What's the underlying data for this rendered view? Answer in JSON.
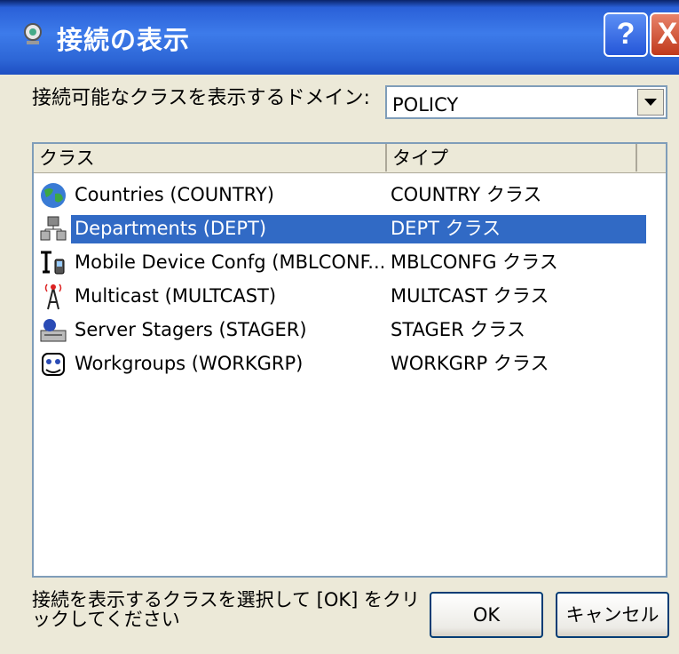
{
  "window": {
    "title": "接続の表示",
    "help_label": "?",
    "close_label": "X"
  },
  "domain": {
    "label": "接続可能なクラスを表示するドメイン:",
    "selected": "POLICY"
  },
  "list": {
    "columns": [
      "クラス",
      "タイプ"
    ],
    "rows": [
      {
        "name": "Countries (COUNTRY)",
        "type": "COUNTRY クラス",
        "icon": "globe-icon"
      },
      {
        "name": "Departments (DEPT)",
        "type": "DEPT クラス",
        "icon": "department-icon",
        "selected": true
      },
      {
        "name": "Mobile Device Confg (MBLCONF...",
        "type": "MBLCONFG クラス",
        "icon": "mobile-device-icon"
      },
      {
        "name": "Multicast (MULTCAST)",
        "type": "MULTCAST クラス",
        "icon": "antenna-icon"
      },
      {
        "name": "Server Stagers (STAGER)",
        "type": "STAGER クラス",
        "icon": "server-icon"
      },
      {
        "name": "Workgroups (WORKGRP)",
        "type": "WORKGRP クラス",
        "icon": "workgroup-icon"
      }
    ]
  },
  "footer": {
    "instruction": "接続を表示するクラスを選択して [OK] をクリックしてください",
    "ok_label": "OK",
    "cancel_label": "キャンセル"
  },
  "colors": {
    "titlebar": "#2D66D6",
    "selection": "#316AC5",
    "dialog_bg": "#ECE9D8"
  }
}
